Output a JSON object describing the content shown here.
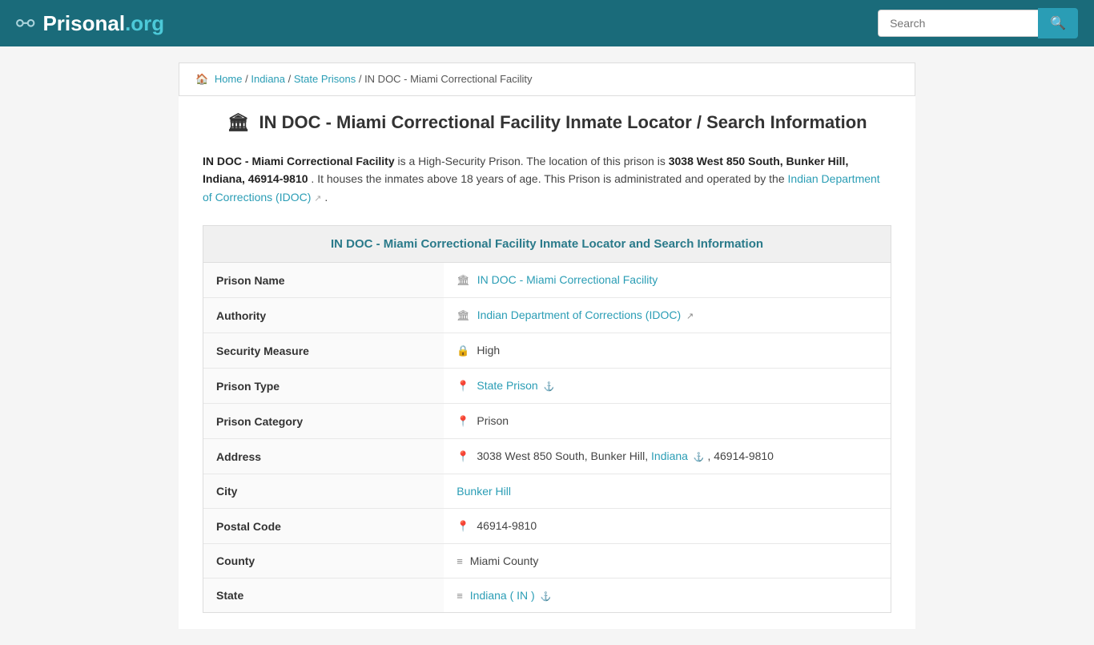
{
  "header": {
    "logo_text": "Prisonal",
    "logo_org": ".org",
    "search_placeholder": "Search",
    "search_button_label": "🔍"
  },
  "breadcrumb": {
    "home_label": "Home",
    "indiana_label": "Indiana",
    "state_prisons_label": "State Prisons",
    "current_label": "IN DOC - Miami Correctional Facility"
  },
  "page_title": "IN DOC - Miami Correctional Facility Inmate Locator / Search Information",
  "description": {
    "facility_name": "IN DOC - Miami Correctional Facility",
    "desc_text": " is a High-Security Prison. The location of this prison is ",
    "address_bold": "3038 West 850 South, Bunker Hill, Indiana, 46914-9810",
    "desc_text2": ". It houses the inmates above 18 years of age. This Prison is administrated and operated by the ",
    "authority_link": "Indian Department of Corrections (IDOC)",
    "desc_text3": "."
  },
  "table_header": "IN DOC - Miami Correctional Facility Inmate Locator and Search Information",
  "table_rows": [
    {
      "label": "Prison Name",
      "icon": "🏛",
      "value_text": "IN DOC - Miami Correctional Facility",
      "value_link": true,
      "anchor": false,
      "ext": false
    },
    {
      "label": "Authority",
      "icon": "🏛",
      "value_text": "Indian Department of Corrections (IDOC)",
      "value_link": true,
      "anchor": false,
      "ext": true
    },
    {
      "label": "Security Measure",
      "icon": "🔒",
      "value_text": "High",
      "value_link": false,
      "anchor": false,
      "ext": false
    },
    {
      "label": "Prison Type",
      "icon": "📍",
      "value_text": "State Prison",
      "value_link": true,
      "anchor": true,
      "ext": false
    },
    {
      "label": "Prison Category",
      "icon": "📍",
      "value_text": "Prison",
      "value_link": false,
      "anchor": false,
      "ext": false
    },
    {
      "label": "Address",
      "icon": "📍",
      "value_text_before": "3038 West 850 South, Bunker Hill, ",
      "value_link": true,
      "link_text": "Indiana",
      "value_text_after": ", 46914-9810",
      "anchor": true,
      "ext": false,
      "complex": true
    },
    {
      "label": "City",
      "icon": "",
      "value_text": "Bunker Hill",
      "value_link": true,
      "anchor": false,
      "ext": false
    },
    {
      "label": "Postal Code",
      "icon": "📍",
      "value_text": "46914-9810",
      "value_link": false,
      "anchor": false,
      "ext": false
    },
    {
      "label": "County",
      "icon": "≡",
      "value_text": "Miami County",
      "value_link": false,
      "anchor": false,
      "ext": false
    },
    {
      "label": "State",
      "icon": "≡",
      "value_text": "Indiana ( IN )",
      "value_link": true,
      "anchor": true,
      "ext": false
    }
  ]
}
